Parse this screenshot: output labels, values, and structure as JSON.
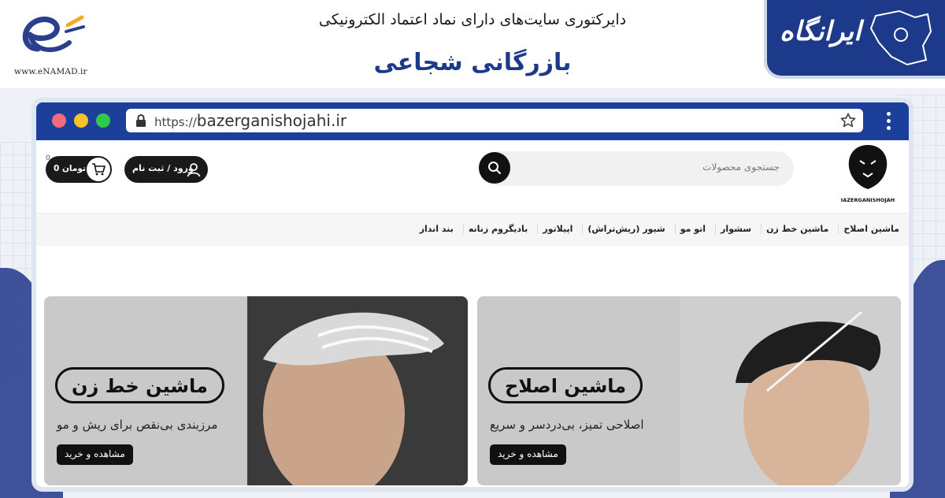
{
  "header": {
    "title": "دایرکتوری سایت‌های دارای نماد اعتماد الکترونیکی",
    "subtitle": "بازرگانی شجاعی",
    "enamad_url": "www.eNAMAD.ir",
    "brand": "ایرانگاه"
  },
  "browser": {
    "url_protocol": "https://",
    "url_domain": "bazerganishojahi.ir"
  },
  "site": {
    "logo_text": "BAZERGANISHOJAHI",
    "search_placeholder": "جستجوی محصولات",
    "login_label": "ورود / ثبت نام",
    "cart_label": "0 تومان",
    "cart_count": "0"
  },
  "nav": {
    "items": [
      "ماشین اصلاح",
      "ماشین خط زن",
      "سشوار",
      "اتو مو",
      "شیور (ریش‌تراش)",
      "اپیلاتور",
      "بادیگروم زنانه",
      "بند انداز"
    ]
  },
  "banners": [
    {
      "title": "ماشین اصلاح",
      "description": "اصلاحی تمیز، بی‌دردسر و سریع",
      "cta": "مشاهده و خرید"
    },
    {
      "title": "ماشین خط زن",
      "description": "مرزبندی بی‌نقص برای ریش و مو",
      "cta": "مشاهده و خرید"
    }
  ],
  "colors": {
    "brand_blue": "#1d3a8a",
    "browser_bar": "#1d3f9c",
    "banner_bg": "#c9c9c9"
  }
}
